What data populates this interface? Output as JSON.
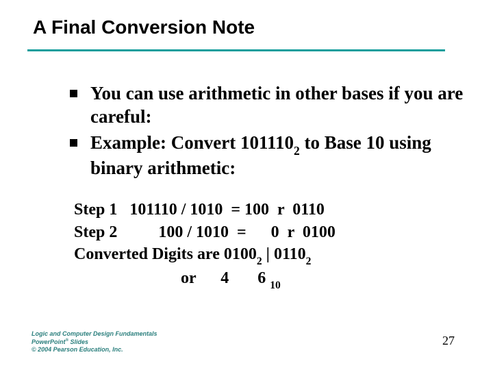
{
  "title": "A Final Conversion Note",
  "bullets": {
    "b1": "You can use arithmetic in other bases if you are careful:",
    "b2_pre": "Example:   Convert 101110",
    "b2_sub": "2",
    "b2_post": " to Base 10 using binary arithmetic:"
  },
  "steps": {
    "s1": "Step 1   101110 / 1010  = 100  r  0110",
    "s2": "Step 2          100 / 1010  =      0  r  0100",
    "s3_pre": "Converted Digits are 0100",
    "s3_sub1": "2",
    "s3_mid": " | 0110",
    "s3_sub2": "2",
    "s4": "                          or      4       6 ",
    "s4_sub": "10"
  },
  "footer": {
    "line1a": "Logic and Computer Design Fundamentals",
    "line2a": "PowerPoint",
    "line2sup": "®",
    "line2b": " Slides",
    "line3": "© 2004 Pearson Education, Inc."
  },
  "page_number": "27"
}
